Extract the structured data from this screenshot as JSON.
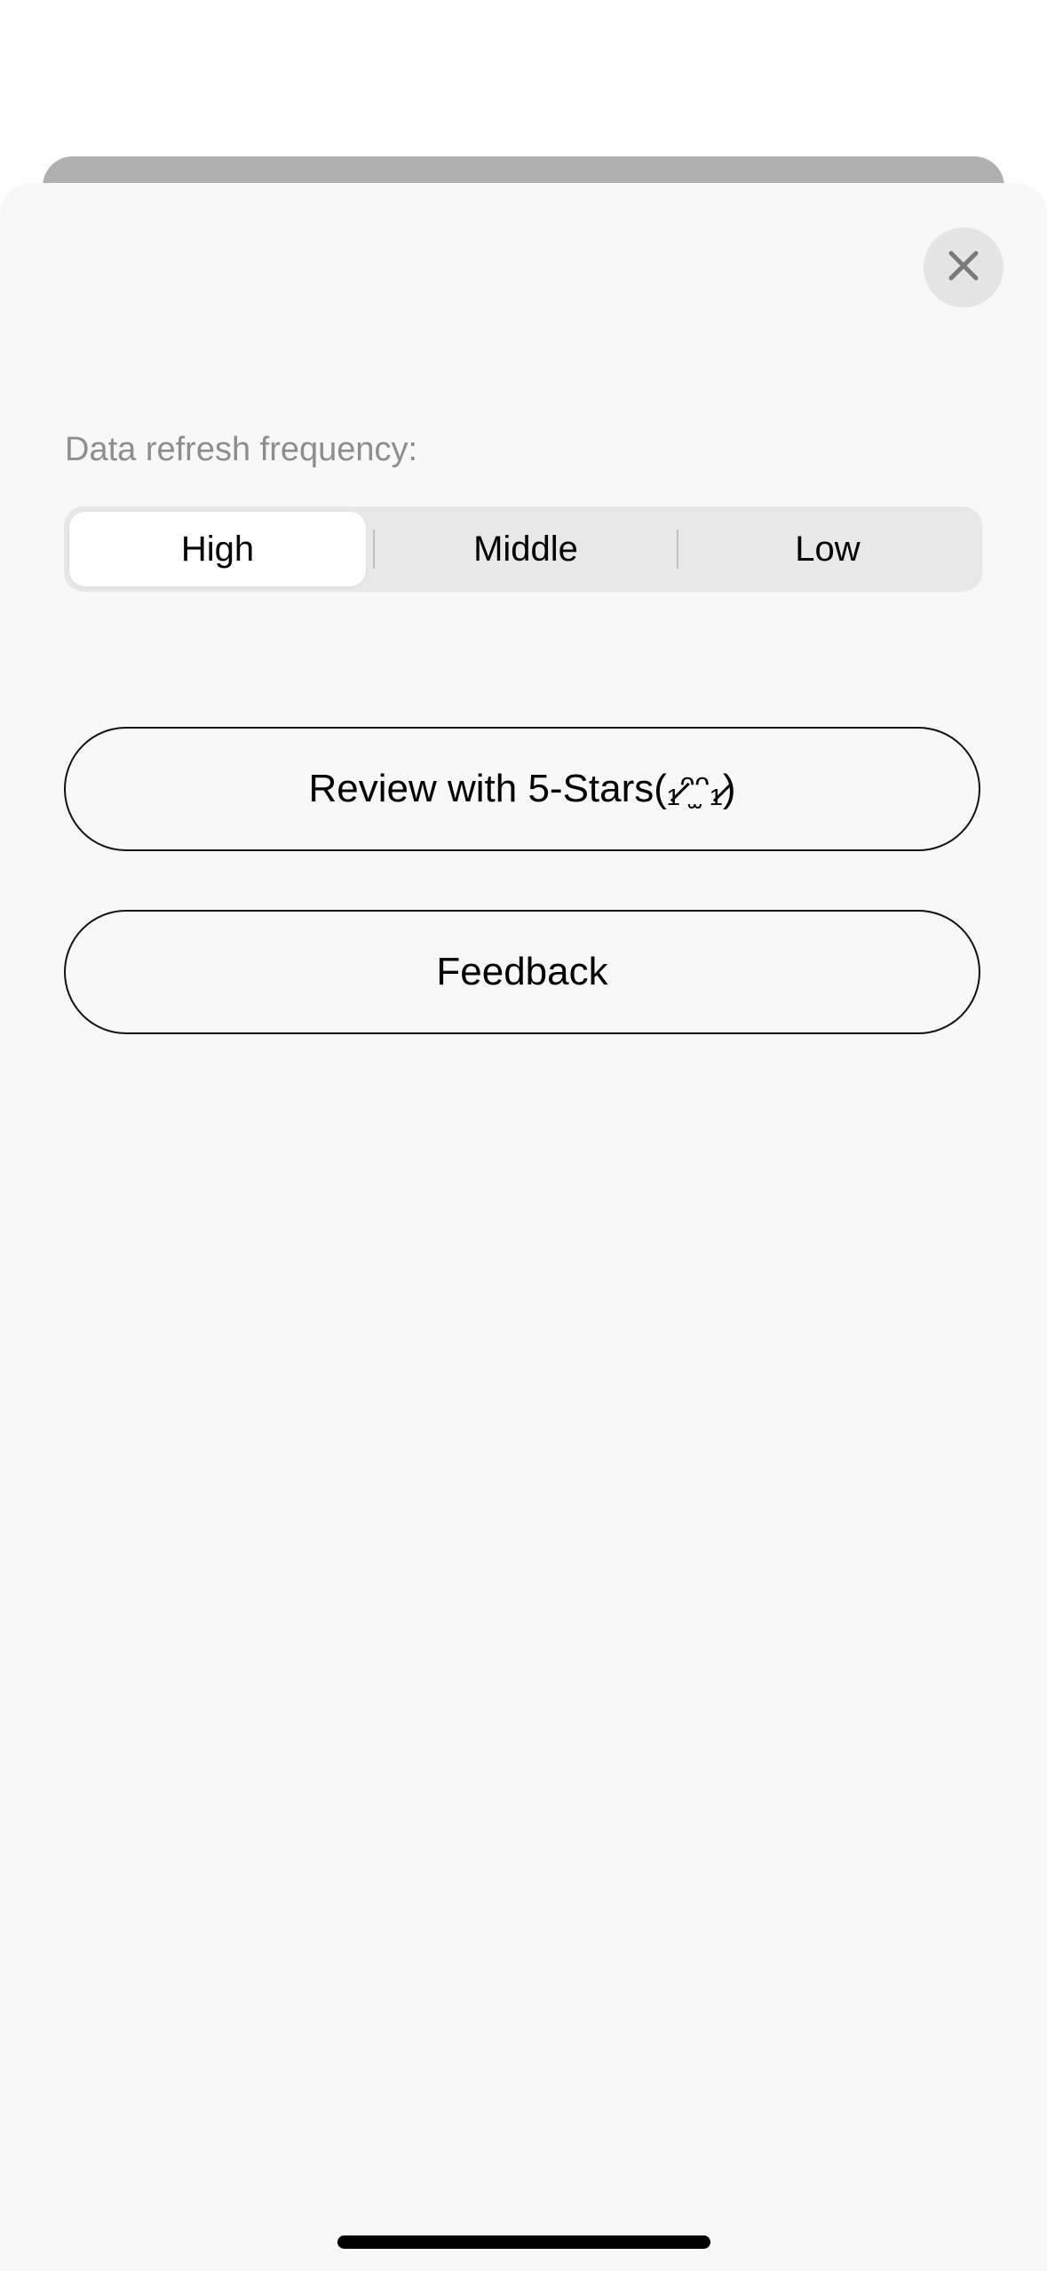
{
  "sheet": {
    "close_icon": "close-icon",
    "settings": {
      "refresh_label": "Data refresh frequency:",
      "refresh_options": [
        "High",
        "Middle",
        "Low"
      ],
      "refresh_selected": "High"
    },
    "buttons": {
      "review_label": "Review with 5-Stars(₁̷ᵔ̫ᵔ₁̷)",
      "feedback_label": "Feedback"
    }
  },
  "colors": {
    "sheet_background": "#f8f8f8",
    "segment_track": "#e8e8e8",
    "segment_selected": "#ffffff",
    "label_gray": "#8e8e8e",
    "close_button_bg": "#e5e5e5"
  }
}
